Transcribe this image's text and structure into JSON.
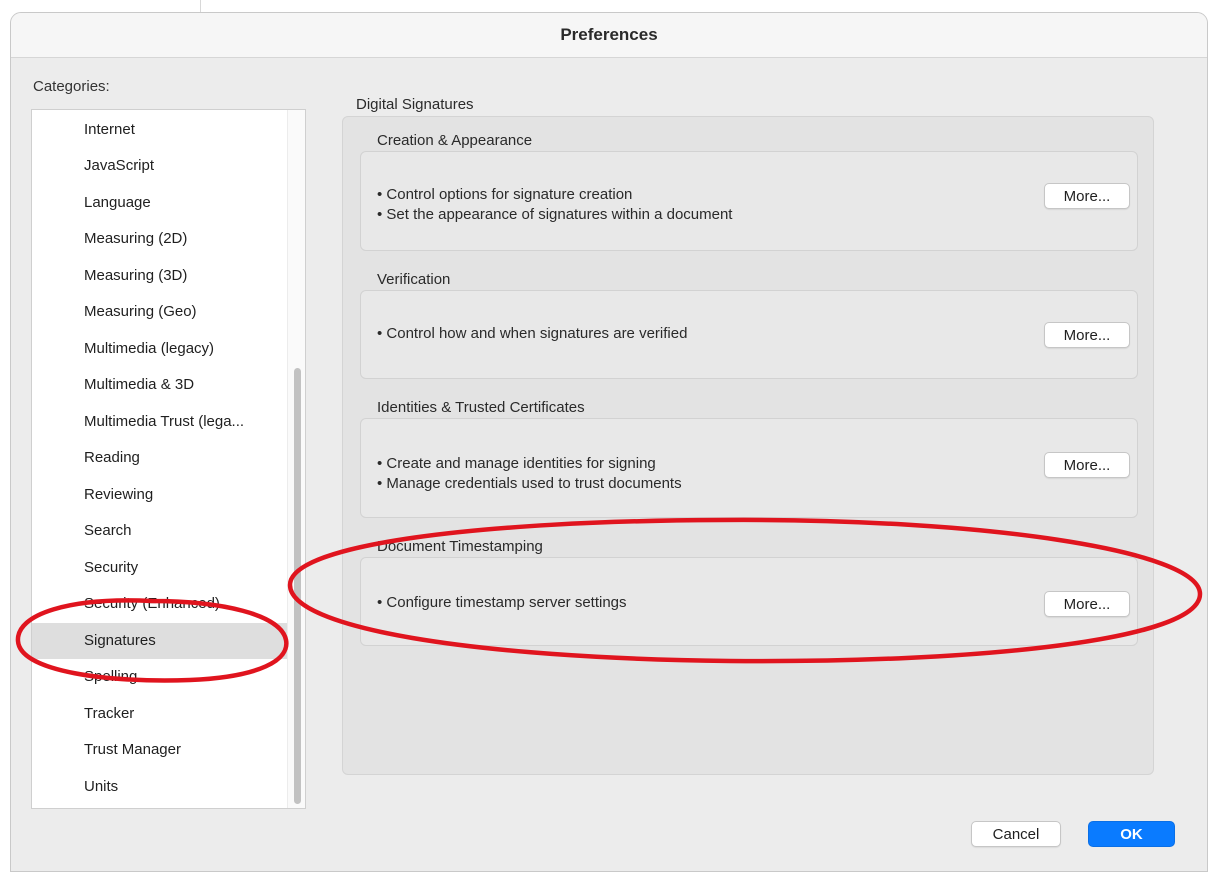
{
  "window": {
    "title": "Preferences"
  },
  "categories": {
    "label": "Categories:",
    "items": [
      "Internet",
      "JavaScript",
      "Language",
      "Measuring (2D)",
      "Measuring (3D)",
      "Measuring (Geo)",
      "Multimedia (legacy)",
      "Multimedia & 3D",
      "Multimedia Trust (lega...",
      "Reading",
      "Reviewing",
      "Search",
      "Security",
      "Security (Enhanced)",
      "Signatures",
      "Spelling",
      "Tracker",
      "Trust Manager",
      "Units"
    ],
    "selected": "Signatures"
  },
  "main": {
    "section_title": "Digital Signatures",
    "groups": [
      {
        "title": "Creation & Appearance",
        "bullets": [
          "• Control options for signature creation",
          "• Set the appearance of signatures within a document"
        ],
        "button": "More..."
      },
      {
        "title": "Verification",
        "bullets": [
          "• Control how and when signatures are verified"
        ],
        "button": "More..."
      },
      {
        "title": "Identities & Trusted Certificates",
        "bullets": [
          "• Create and manage identities for signing",
          "• Manage credentials used to trust documents"
        ],
        "button": "More..."
      },
      {
        "title": "Document Timestamping",
        "bullets": [
          "• Configure timestamp server settings"
        ],
        "button": "More..."
      }
    ]
  },
  "footer": {
    "cancel": "Cancel",
    "ok": "OK"
  },
  "colors": {
    "accent": "#0a7bff",
    "annotation": "#e0141e",
    "selection": "#dedede"
  }
}
